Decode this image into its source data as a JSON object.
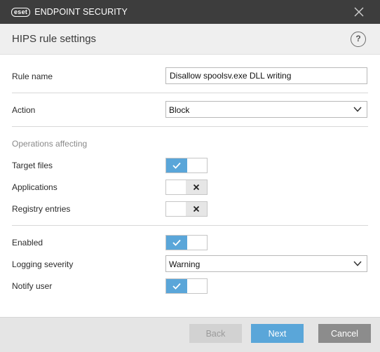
{
  "app": {
    "logo_badge": "eset",
    "logo_text": "ENDPOINT SECURITY"
  },
  "dialog": {
    "title": "HIPS rule settings",
    "help_label": "?"
  },
  "form": {
    "rule_name_label": "Rule name",
    "rule_name_value": "Disallow spoolsv.exe DLL writing",
    "action_label": "Action",
    "action_value": "Block",
    "operations_label": "Operations affecting",
    "target_files_label": "Target files",
    "target_files_on": true,
    "applications_label": "Applications",
    "applications_on": false,
    "registry_label": "Registry entries",
    "registry_on": false,
    "enabled_label": "Enabled",
    "enabled_on": true,
    "logging_label": "Logging severity",
    "logging_value": "Warning",
    "notify_label": "Notify user",
    "notify_on": true
  },
  "buttons": {
    "back": "Back",
    "next": "Next",
    "cancel": "Cancel"
  },
  "colors": {
    "accent": "#5aa6d9",
    "titlebar": "#3d3d3d",
    "header": "#efefef",
    "footer": "#e5e5e5",
    "cancel": "#8c8c8c",
    "back_disabled": "#d2d2d2"
  }
}
